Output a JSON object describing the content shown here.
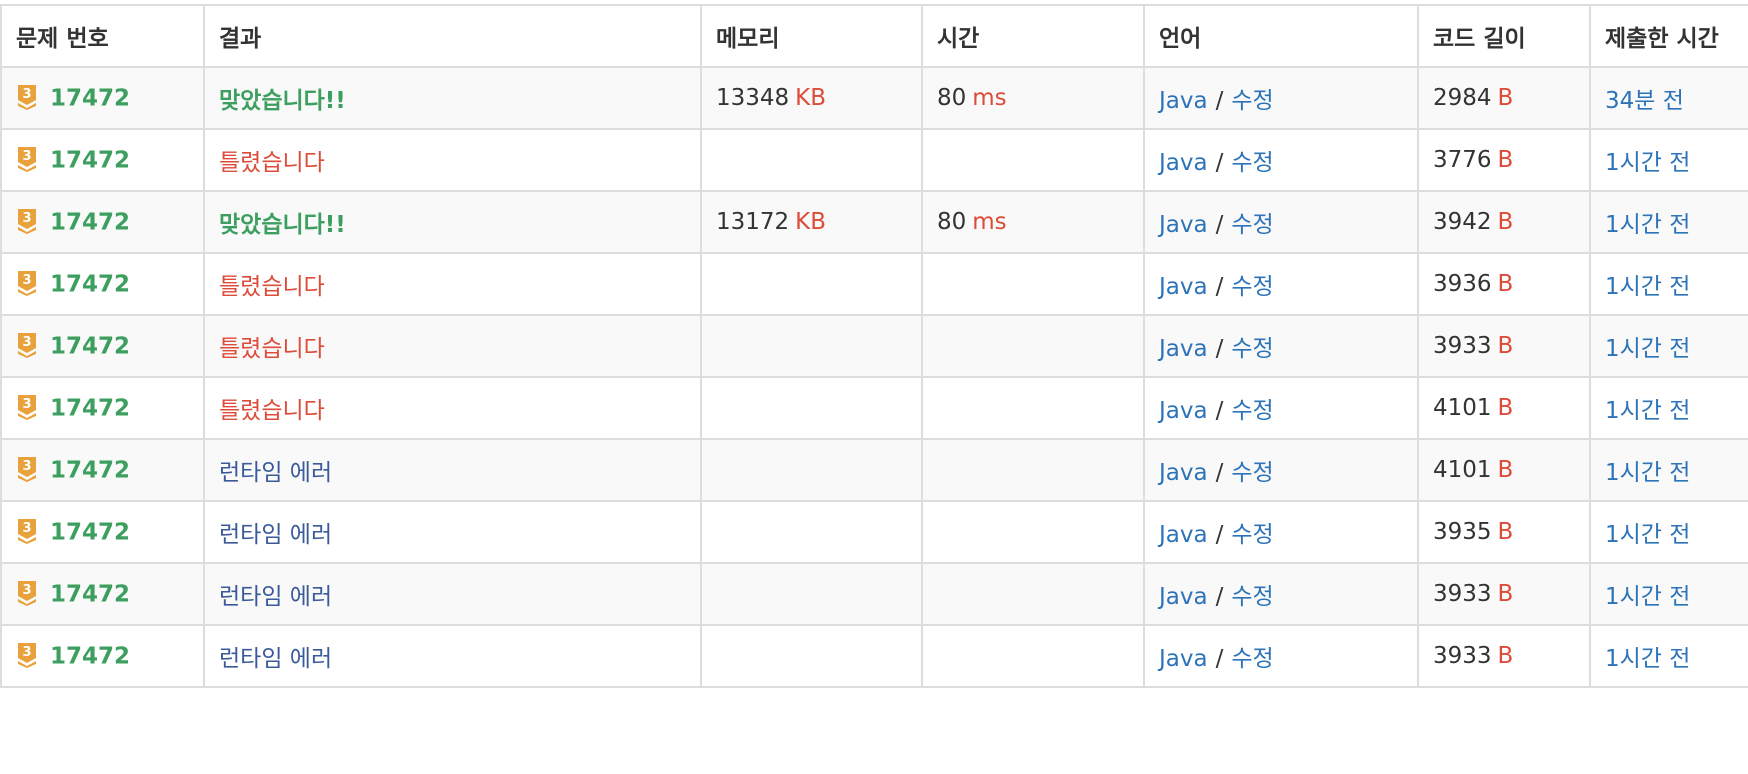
{
  "header": {
    "problem": "문제 번호",
    "result": "결과",
    "memory": "메모리",
    "time": "시간",
    "language": "언어",
    "code_length": "코드 길이",
    "submitted_at": "제출한 시간"
  },
  "colors": {
    "accepted": "#3c9f5f",
    "wrong": "#dd4b39",
    "runtime_error": "#3a5a9a",
    "link": "#2c73b8",
    "unit": "#dd4b39",
    "tier_badge": "#e9a23b"
  },
  "tier_icon": "bronze-tier-3-icon",
  "rows": [
    {
      "tier": "3",
      "problem": "17472",
      "result": "맞았습니다!!",
      "result_type": "accepted",
      "memory": "13348",
      "memory_unit": "KB",
      "time": "80",
      "time_unit": "ms",
      "lang": "Java",
      "sep": "/",
      "edit": "수정",
      "code_len": "2984",
      "code_unit": "B",
      "submitted": "34분 전"
    },
    {
      "tier": "3",
      "problem": "17472",
      "result": "틀렸습니다",
      "result_type": "wrong",
      "memory": "",
      "memory_unit": "",
      "time": "",
      "time_unit": "",
      "lang": "Java",
      "sep": "/",
      "edit": "수정",
      "code_len": "3776",
      "code_unit": "B",
      "submitted": "1시간 전"
    },
    {
      "tier": "3",
      "problem": "17472",
      "result": "맞았습니다!!",
      "result_type": "accepted",
      "memory": "13172",
      "memory_unit": "KB",
      "time": "80",
      "time_unit": "ms",
      "lang": "Java",
      "sep": "/",
      "edit": "수정",
      "code_len": "3942",
      "code_unit": "B",
      "submitted": "1시간 전"
    },
    {
      "tier": "3",
      "problem": "17472",
      "result": "틀렸습니다",
      "result_type": "wrong",
      "memory": "",
      "memory_unit": "",
      "time": "",
      "time_unit": "",
      "lang": "Java",
      "sep": "/",
      "edit": "수정",
      "code_len": "3936",
      "code_unit": "B",
      "submitted": "1시간 전"
    },
    {
      "tier": "3",
      "problem": "17472",
      "result": "틀렸습니다",
      "result_type": "wrong",
      "memory": "",
      "memory_unit": "",
      "time": "",
      "time_unit": "",
      "lang": "Java",
      "sep": "/",
      "edit": "수정",
      "code_len": "3933",
      "code_unit": "B",
      "submitted": "1시간 전"
    },
    {
      "tier": "3",
      "problem": "17472",
      "result": "틀렸습니다",
      "result_type": "wrong",
      "memory": "",
      "memory_unit": "",
      "time": "",
      "time_unit": "",
      "lang": "Java",
      "sep": "/",
      "edit": "수정",
      "code_len": "4101",
      "code_unit": "B",
      "submitted": "1시간 전"
    },
    {
      "tier": "3",
      "problem": "17472",
      "result": "런타임 에러",
      "result_type": "runtime_error",
      "memory": "",
      "memory_unit": "",
      "time": "",
      "time_unit": "",
      "lang": "Java",
      "sep": "/",
      "edit": "수정",
      "code_len": "4101",
      "code_unit": "B",
      "submitted": "1시간 전"
    },
    {
      "tier": "3",
      "problem": "17472",
      "result": "런타임 에러",
      "result_type": "runtime_error",
      "memory": "",
      "memory_unit": "",
      "time": "",
      "time_unit": "",
      "lang": "Java",
      "sep": "/",
      "edit": "수정",
      "code_len": "3935",
      "code_unit": "B",
      "submitted": "1시간 전"
    },
    {
      "tier": "3",
      "problem": "17472",
      "result": "런타임 에러",
      "result_type": "runtime_error",
      "memory": "",
      "memory_unit": "",
      "time": "",
      "time_unit": "",
      "lang": "Java",
      "sep": "/",
      "edit": "수정",
      "code_len": "3933",
      "code_unit": "B",
      "submitted": "1시간 전"
    },
    {
      "tier": "3",
      "problem": "17472",
      "result": "런타임 에러",
      "result_type": "runtime_error",
      "memory": "",
      "memory_unit": "",
      "time": "",
      "time_unit": "",
      "lang": "Java",
      "sep": "/",
      "edit": "수정",
      "code_len": "3933",
      "code_unit": "B",
      "submitted": "1시간 전"
    }
  ]
}
